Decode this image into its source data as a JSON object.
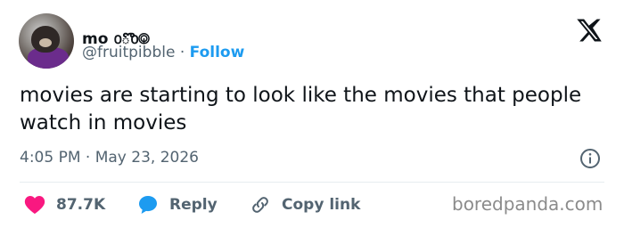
{
  "author": {
    "display_name": "mo ൦ొ൦࿃",
    "handle": "@fruitpibble",
    "separator": "·",
    "follow_label": "Follow"
  },
  "tweet": {
    "text": "movies are starting to look like the movies that people watch in movies",
    "time": "4:05 PM",
    "dot": "·",
    "date": "May 23, 2026"
  },
  "actions": {
    "likes_count": "87.7K",
    "reply_label": "Reply",
    "copy_label": "Copy link"
  },
  "watermark": "boredpanda.com",
  "colors": {
    "heart": "#f91880",
    "reply_bubble": "#1d9bf0",
    "follow": "#1d9bf0"
  },
  "icons": [
    "x-logo-icon",
    "info-icon",
    "heart-icon",
    "reply-bubble-icon",
    "link-icon"
  ]
}
